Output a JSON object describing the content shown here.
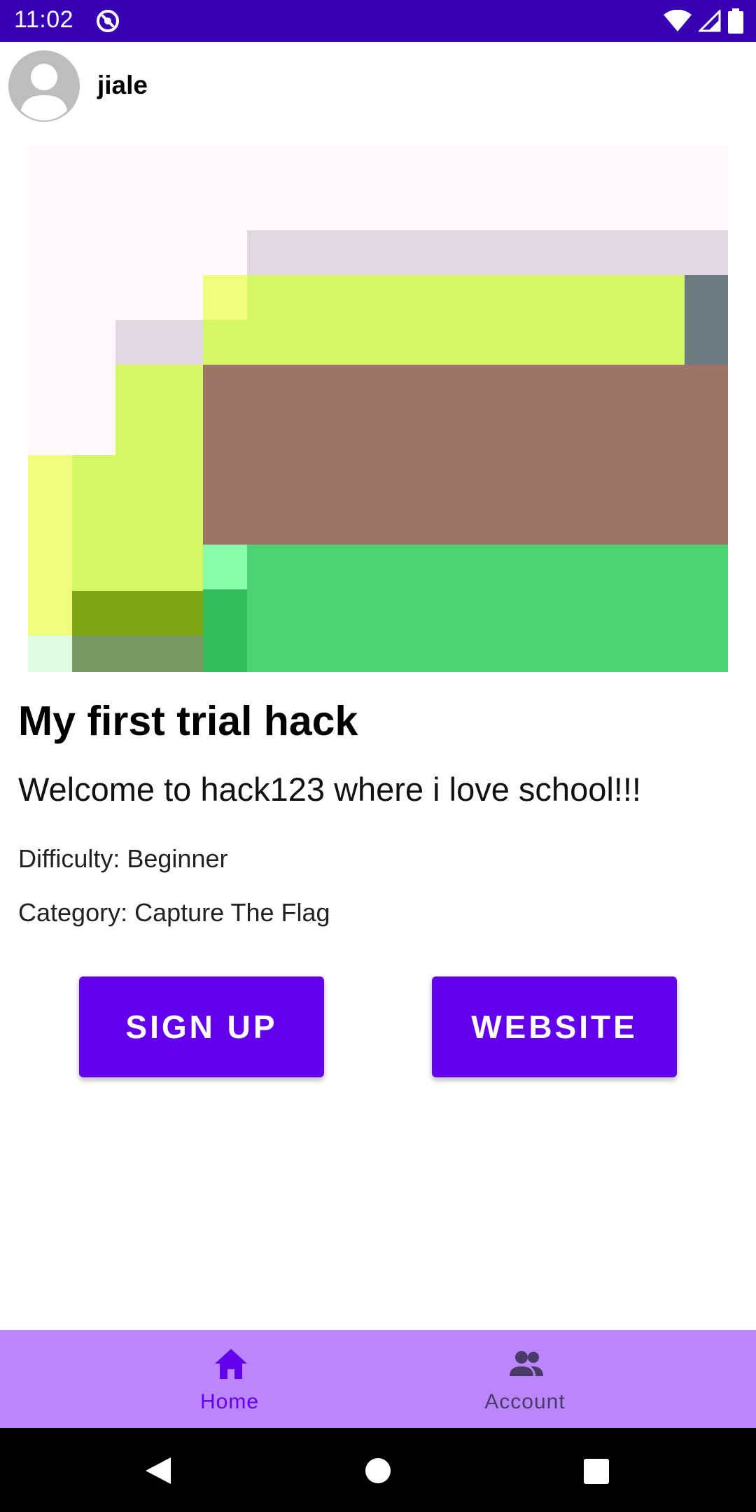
{
  "status_bar": {
    "time": "11:02",
    "background": "#3700b3",
    "icons": [
      "app-notification-icon",
      "wifi-icon",
      "signal-icon",
      "battery-icon"
    ]
  },
  "user": {
    "username": "jiale",
    "avatar_icon": "person-avatar-icon"
  },
  "hack": {
    "title": "My first trial hack",
    "description": "Welcome to hack123 where i love school!!!",
    "difficulty": "Difficulty: Beginner",
    "category": "Category: Capture The Flag"
  },
  "actions": {
    "signup_label": "SIGN UP",
    "website_label": "WEBSITE",
    "button_color": "#6200ee"
  },
  "bottom_nav": {
    "background": "#bb86fc",
    "items": [
      {
        "label": "Home",
        "icon": "home-icon",
        "selected": true
      },
      {
        "label": "Account",
        "icon": "people-icon",
        "selected": false
      }
    ]
  },
  "system_nav": {
    "icons": [
      "back-icon",
      "home-circle-icon",
      "recents-icon"
    ]
  }
}
